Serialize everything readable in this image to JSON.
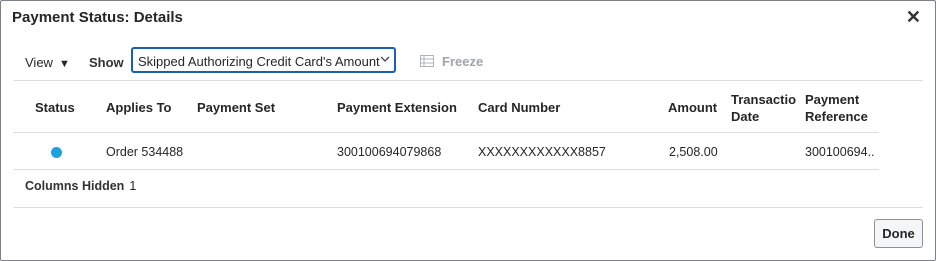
{
  "dialog": {
    "title": "Payment Status: Details",
    "close_label": "✕"
  },
  "toolbar": {
    "view_label": "View",
    "view_caret": "▼",
    "show_label": "Show",
    "show_value": "Skipped Authorizing Credit Card's Amount",
    "freeze_label": "Freeze"
  },
  "table": {
    "columns": [
      "Status",
      "Applies To",
      "Payment Set",
      "Payment Extension",
      "Card Number",
      "Amount",
      "Transactio",
      "Date",
      "Payment",
      "Reference"
    ],
    "row": {
      "status_color": "#1ba0e0",
      "applies_to": "Order 534488",
      "payment_set": "",
      "payment_extension": "300100694079868",
      "card_number": "XXXXXXXXXXXX8857",
      "amount": "2,508.00",
      "transaction_date": "",
      "payment_reference": "300100694.."
    }
  },
  "footer": {
    "columns_hidden_label": "Columns Hidden",
    "columns_hidden_count": "1"
  },
  "actions": {
    "done_label": "Done"
  }
}
